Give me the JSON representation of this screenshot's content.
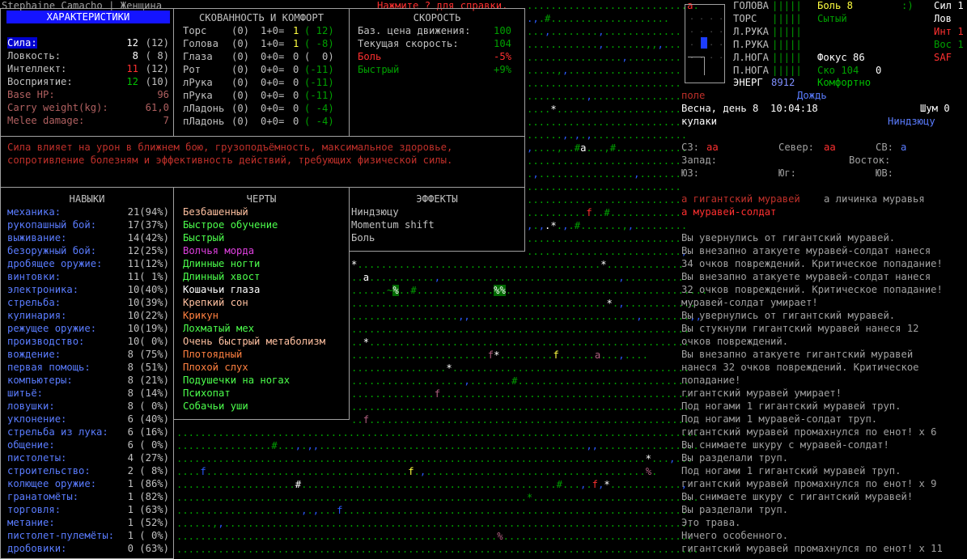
{
  "title_bar": {
    "character": "Stephaine Camacho | Женщина",
    "help": "Нажмите ? для справки."
  },
  "stats": {
    "header": "ХАРАКТЕРИСТИКИ",
    "rows": [
      {
        "label": "Сила:",
        "value": "12",
        "base": "(12)",
        "selected": true
      },
      {
        "label": "Ловкость:",
        "value": "8",
        "base": "( 8)"
      },
      {
        "label": "Интеллект:",
        "value": "11",
        "base": "(12)"
      },
      {
        "label": "Восприятие:",
        "value": "12",
        "base": "(10)"
      },
      {
        "label": "Base HP:",
        "value": "96"
      },
      {
        "label": "Carry weight(kg):",
        "value": "61,0"
      },
      {
        "label": "Melee damage:",
        "value": "7"
      }
    ],
    "description": "Сила влияет на урон в ближнем бою, грузоподъёмность, максимальное здоровье,\nсопротивление болезням и эффективность действий, требующих физической силы."
  },
  "encumbrance": {
    "header": "СКОВАННОСТЬ И КОМФОРТ",
    "rows": [
      {
        "part": "Торс",
        "a": "(0)",
        "b": "1+0=",
        "c": "1",
        "d": "( 12)"
      },
      {
        "part": "Голова",
        "a": "(0)",
        "b": "1+0=",
        "c": "1",
        "d": "( -8)"
      },
      {
        "part": "Глаза",
        "a": "(0)",
        "b": "0+0=",
        "c": "0",
        "d": "(  0)"
      },
      {
        "part": "Рот",
        "a": "(0)",
        "b": "0+0=",
        "c": "0",
        "d": "(-11)"
      },
      {
        "part": "лРука",
        "a": "(0)",
        "b": "0+0=",
        "c": "0",
        "d": "(-11)"
      },
      {
        "part": "пРука",
        "a": "(0)",
        "b": "0+0=",
        "c": "0",
        "d": "(-11)"
      },
      {
        "part": "лЛадонь",
        "a": "(0)",
        "b": "0+0=",
        "c": "0",
        "d": "( -4)"
      },
      {
        "part": "пЛадонь",
        "a": "(0)",
        "b": "0+0=",
        "c": "0",
        "d": "( -4)"
      }
    ]
  },
  "speed": {
    "header": "СКОРОСТЬ",
    "rows": [
      {
        "label": "Баз. цена движения:",
        "value": "100"
      },
      {
        "label": "Текущая скорость:",
        "value": "104"
      },
      {
        "label": "Боль",
        "value": "-5%"
      },
      {
        "label": "Быстрый",
        "value": "+9%"
      }
    ]
  },
  "skills": {
    "header": "НАВЫКИ",
    "rows": [
      {
        "name": "механика:",
        "value": "21(94%)"
      },
      {
        "name": "рукопашный бой:",
        "value": "17(37%)"
      },
      {
        "name": "выживание:",
        "value": "14(42%)"
      },
      {
        "name": "безоружный бой:",
        "value": "12(25%)"
      },
      {
        "name": "дробящее оружие:",
        "value": "11(12%)"
      },
      {
        "name": "винтовки:",
        "value": "11( 1%)"
      },
      {
        "name": "электроника:",
        "value": "10(40%)"
      },
      {
        "name": "стрельба:",
        "value": "10(39%)"
      },
      {
        "name": "кулинария:",
        "value": "10(22%)"
      },
      {
        "name": "режущее оружие:",
        "value": "10(19%)"
      },
      {
        "name": "производство:",
        "value": "10( 0%)"
      },
      {
        "name": "вождение:",
        "value": "8 (75%)"
      },
      {
        "name": "первая помощь:",
        "value": "8 (51%)"
      },
      {
        "name": "компьютеры:",
        "value": "8 (21%)"
      },
      {
        "name": "шитьё:",
        "value": "8 (14%)"
      },
      {
        "name": "ловушки:",
        "value": "8 ( 0%)"
      },
      {
        "name": "уклонение:",
        "value": "6 (40%)"
      },
      {
        "name": "стрельба из лука:",
        "value": "6 (16%)"
      },
      {
        "name": "общение:",
        "value": "6 ( 0%)"
      },
      {
        "name": "пистолеты:",
        "value": "4 (27%)"
      },
      {
        "name": "строительство:",
        "value": "2 ( 8%)"
      },
      {
        "name": "колющее оружие:",
        "value": "1 (86%)"
      },
      {
        "name": "гранатомёты:",
        "value": "1 (82%)"
      },
      {
        "name": "торговля:",
        "value": "1 (63%)"
      },
      {
        "name": "метание:",
        "value": "1 (52%)"
      },
      {
        "name": "пистолет-пулемёты:",
        "value": "1 ( 0%)"
      },
      {
        "name": "дробовики:",
        "value": "0 (63%)"
      }
    ]
  },
  "traits": {
    "header": "ЧЕРТЫ",
    "rows": [
      {
        "name": "Безбашенный",
        "color": "#ffc0a0"
      },
      {
        "name": "Быстрое обучение",
        "color": "#4cff4c"
      },
      {
        "name": "Быстрый",
        "color": "#4cff4c"
      },
      {
        "name": "Волчья морда",
        "color": "#e040e0"
      },
      {
        "name": "Длинные ногти",
        "color": "#4cff4c"
      },
      {
        "name": "Длинный хвост",
        "color": "#4cff4c"
      },
      {
        "name": "Кошачьи глаза",
        "color": "#ffffff"
      },
      {
        "name": "Крепкий сон",
        "color": "#ffc0a0"
      },
      {
        "name": "Крикун",
        "color": "#ff8040"
      },
      {
        "name": "Лохматый мех",
        "color": "#4cff4c"
      },
      {
        "name": "Очень быстрый метаболизм",
        "color": "#ffc0a0"
      },
      {
        "name": "Плотоядный",
        "color": "#ff8040"
      },
      {
        "name": "Плохой слух",
        "color": "#ff8040"
      },
      {
        "name": "Подушечки на ногах",
        "color": "#4cff4c"
      },
      {
        "name": "Психопат",
        "color": "#4cff4c"
      },
      {
        "name": "Собачьи уши",
        "color": "#4cff4c"
      }
    ]
  },
  "effects": {
    "header": "ЭФФЕКТЫ",
    "rows": [
      "Ниндзюцу",
      "Momentum shift",
      "Боль"
    ]
  },
  "sidebar": {
    "body": [
      {
        "part": "ГОЛОВА",
        "bar": "|||||",
        "status": "Боль 8",
        "status_color": "#ffff40",
        "extra": ":)",
        "right": "Сил 1",
        "right_color": "#ffffff"
      },
      {
        "part": "ТОРС",
        "bar": "|||||",
        "status": "Сытый",
        "status_color": "#00a000",
        "extra": "",
        "right": "Лов",
        "right_color": "#ffffff"
      },
      {
        "part": "Л.РУКА",
        "bar": "|||||",
        "status": "",
        "extra": "",
        "right": "Инт 1",
        "right_color": "#ff3030"
      },
      {
        "part": "П.РУКА",
        "bar": "|||||",
        "status": "",
        "extra": "",
        "right": "Вос 1",
        "right_color": "#00a000"
      },
      {
        "part": "Л.НОГА",
        "bar": "|||||",
        "status": "Фокус 86",
        "status_color": "#ffffff",
        "extra": "",
        "right": "SAF",
        "right_color": "#ff3030"
      },
      {
        "part": "П.НОГА",
        "bar": "|||||",
        "status": "Ско 104",
        "status_color": "#00a000",
        "extra": "0",
        "right": "",
        "right_color": "#ffffff"
      }
    ],
    "energy_label": "ЭНЕРГ",
    "energy_value": "8912",
    "comfort": "Комфортно",
    "terrain": "поле",
    "weather": "Дождь",
    "date_time": "Весна, день 8  10:04:18",
    "noise": "Шум 0",
    "weapon": "кулаки",
    "style": "Ниндзюцу",
    "compass": {
      "nw_label": "СЗ:",
      "nw_value": "аа",
      "n_label": "Север:",
      "n_value": "аа",
      "ne_label": "СВ:",
      "ne_value": "а",
      "w_label": "Запад:",
      "e_label": "Восток:",
      "sw_label": "ЮЗ:",
      "s_label": "Юг:",
      "se_label": "ЮВ:"
    },
    "monsters_line1_a": "а гигантский муравей",
    "monsters_line1_b": "а личинка муравья",
    "monsters_line2": "а муравей-солдат"
  },
  "log": [
    {
      "text": "Вы увернулись от гигантский муравей.",
      "color": "#a0a0a0"
    },
    {
      "text": "Вы внезапно атакуете муравей-солдат нанеся",
      "color": "#a0a0a0"
    },
    {
      "text": "34 очков повреждений. Критическое попадание!",
      "color": "#a0a0a0"
    },
    {
      "text": "Вы внезапно атакуете муравей-солдат нанеся",
      "color": "#a0a0a0"
    },
    {
      "text": "32 очков повреждений. Критическое попадание!",
      "color": "#a0a0a0"
    },
    {
      "text": "муравей-солдат умирает!",
      "color": "#a0a0a0"
    },
    {
      "text": "Вы увернулись от гигантский муравей.",
      "color": "#a0a0a0"
    },
    {
      "text": "Вы стукнули гигантский муравей нанеся 12",
      "color": "#a0a0a0"
    },
    {
      "text": "очков повреждений.",
      "color": "#a0a0a0"
    },
    {
      "text": "Вы внезапно атакуете гигантский муравей",
      "color": "#a0a0a0"
    },
    {
      "text": "нанеся 32 очков повреждений. Критическое",
      "color": "#a0a0a0"
    },
    {
      "text": "попадание!",
      "color": "#a0a0a0"
    },
    {
      "text": "гигантский муравей умирает!",
      "color": "#a0a0a0"
    },
    {
      "text": "Под ногами 1 гигантский муравей труп.",
      "color": "#a0a0a0"
    },
    {
      "text": "Под ногами 1 муравей-солдат труп.",
      "color": "#a0a0a0"
    },
    {
      "text": "гигантский муравей промахнулся по енот! x 6",
      "color": "#a0a0a0"
    },
    {
      "text": "Вы снимаете шкуру с муравей-солдат!",
      "color": "#a0a0a0"
    },
    {
      "text": "Вы разделали труп.",
      "color": "#a0a0a0"
    },
    {
      "text": "Под ногами 1 гигантский муравей труп.",
      "color": "#a0a0a0"
    },
    {
      "text": "гигантский муравей промахнулся по енот! x 9",
      "color": "#a0a0a0"
    },
    {
      "text": "Вы снимаете шкуру с гигантский муравей!",
      "color": "#a0a0a0"
    },
    {
      "text": "Вы разделали труп.",
      "color": "#a0a0a0"
    },
    {
      "text": "Это трава.",
      "color": "#a0a0a0"
    },
    {
      "text": "Ничего особенного.",
      "color": "#a0a0a0"
    },
    {
      "text": "гигантский муравей промахнулся по енот! x 11",
      "color": "#a0a0a0"
    }
  ],
  "colors": {
    "border": "#a0a0a0",
    "selection": "#0000d0",
    "grass": "#00a000",
    "skill_name": "#5a7cff"
  }
}
